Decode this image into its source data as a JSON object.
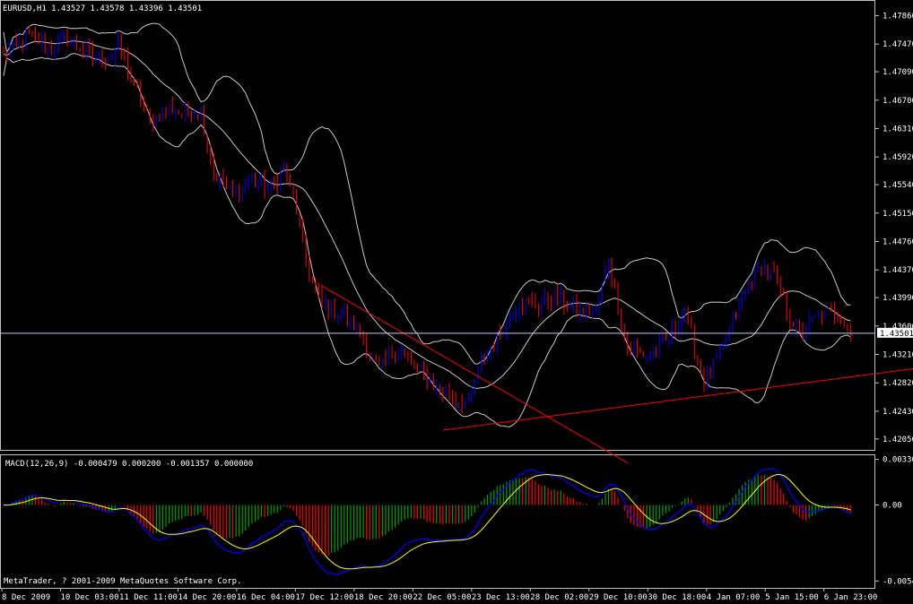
{
  "chart_data": [
    {
      "type": "candlestick",
      "symbol_header": "EURUSD,H1  1.43527 1.43578 1.43396 1.43501",
      "current_price": 1.43501,
      "current_price_label": "1.43501",
      "ylim": [
        1.419,
        1.4805
      ],
      "y_ticks": [
        {
          "v": 1.4786,
          "label": "1.47860"
        },
        {
          "v": 1.4747,
          "label": "1.47470"
        },
        {
          "v": 1.4709,
          "label": "1.47090"
        },
        {
          "v": 1.467,
          "label": "1.46700"
        },
        {
          "v": 1.4631,
          "label": "1.46310"
        },
        {
          "v": 1.4592,
          "label": "1.45920"
        },
        {
          "v": 1.4554,
          "label": "1.45540"
        },
        {
          "v": 1.4515,
          "label": "1.45150"
        },
        {
          "v": 1.4476,
          "label": "1.44760"
        },
        {
          "v": 1.4437,
          "label": "1.44370"
        },
        {
          "v": 1.4399,
          "label": "1.43990"
        },
        {
          "v": 1.436,
          "label": "1.43600"
        },
        {
          "v": 1.4321,
          "label": "1.43210"
        },
        {
          "v": 1.4282,
          "label": "1.42820"
        },
        {
          "v": 1.4243,
          "label": "1.42430"
        },
        {
          "v": 1.4205,
          "label": "1.42050"
        }
      ],
      "indicators": [
        "Bollinger Bands"
      ],
      "close_path_anchors": [
        [
          0,
          1.473
        ],
        [
          8,
          1.476
        ],
        [
          14,
          1.474
        ],
        [
          20,
          1.4755
        ],
        [
          28,
          1.473
        ],
        [
          34,
          1.473
        ],
        [
          36,
          1.475
        ],
        [
          40,
          1.47
        ],
        [
          46,
          1.464
        ],
        [
          52,
          1.466
        ],
        [
          56,
          1.465
        ],
        [
          62,
          1.4655
        ],
        [
          66,
          1.457
        ],
        [
          72,
          1.454
        ],
        [
          78,
          1.456
        ],
        [
          84,
          1.455
        ],
        [
          88,
          1.4575
        ],
        [
          92,
          1.452
        ],
        [
          96,
          1.443
        ],
        [
          100,
          1.439
        ],
        [
          106,
          1.438
        ],
        [
          112,
          1.435
        ],
        [
          118,
          1.43
        ],
        [
          124,
          1.433
        ],
        [
          130,
          1.43
        ],
        [
          136,
          1.4275
        ],
        [
          142,
          1.426
        ],
        [
          146,
          1.4255
        ],
        [
          150,
          1.431
        ],
        [
          156,
          1.435
        ],
        [
          162,
          1.4395
        ],
        [
          168,
          1.439
        ],
        [
          174,
          1.44
        ],
        [
          180,
          1.438
        ],
        [
          186,
          1.438
        ],
        [
          190,
          1.445
        ],
        [
          196,
          1.433
        ],
        [
          202,
          1.432
        ],
        [
          208,
          1.434
        ],
        [
          214,
          1.438
        ],
        [
          220,
          1.428
        ],
        [
          226,
          1.433
        ],
        [
          232,
          1.44
        ],
        [
          238,
          1.444
        ],
        [
          242,
          1.443
        ],
        [
          246,
          1.438
        ],
        [
          250,
          1.435
        ],
        [
          256,
          1.4375
        ],
        [
          262,
          1.438
        ],
        [
          266,
          1.435
        ]
      ],
      "trendlines": [
        {
          "from": [
            100,
            1.4415
          ],
          "to": [
            196,
            1.4172
          ],
          "color": "#ff0000"
        },
        {
          "from": [
            138,
            1.4217
          ],
          "to": [
            292,
            1.4305
          ],
          "color": "#ff0000"
        }
      ]
    },
    {
      "type": "bar+line",
      "title": "MACD(12,26,9) -0.000479 0.000200 -0.001357 0.000000",
      "ylim": [
        -0.006,
        0.0036
      ],
      "y_ticks": [
        {
          "v": 0.0033,
          "label": "0.00330"
        },
        {
          "v": 0.0,
          "label": "0.00"
        },
        {
          "v": -0.0055,
          "label": "-0.00548"
        }
      ],
      "series": [
        {
          "name": "",
          "kind": "histogram",
          "colors": [
            "#00a000",
            "#ff0000"
          ]
        },
        {
          "name": "",
          "kind": "line",
          "color": "#0000ff"
        },
        {
          "name": "",
          "kind": "line",
          "color": "#ffff00"
        }
      ]
    }
  ],
  "x_ticks": [
    {
      "i": 0,
      "label": "8 Dec 2009"
    },
    {
      "i": 16,
      "label": "10 Dec 03:00"
    },
    {
      "i": 32,
      "label": "11 Dec 11:00"
    },
    {
      "i": 48,
      "label": "14 Dec 20:00"
    },
    {
      "i": 64,
      "label": "16 Dec 04:00"
    },
    {
      "i": 80,
      "label": "17 Dec 12:00"
    },
    {
      "i": 96,
      "label": "18 Dec 20:00"
    },
    {
      "i": 112,
      "label": "22 Dec 05:00"
    },
    {
      "i": 128,
      "label": "23 Dec 13:00"
    },
    {
      "i": 144,
      "label": "28 Dec 02:00"
    },
    {
      "i": 160,
      "label": "29 Dec 10:00"
    },
    {
      "i": 176,
      "label": "30 Dec 18:00"
    },
    {
      "i": 192,
      "label": "4 Jan 07:00"
    },
    {
      "i": 208,
      "label": "5 Jan 15:00"
    },
    {
      "i": 224,
      "label": "6 Jan 23:00"
    }
  ],
  "copyright": "MetaTrader, ? 2001-2009 MetaQuotes Software Corp.",
  "colors": {
    "background": "#000000",
    "bull": "#0000ff",
    "bear": "#ff0000",
    "bands": "#c8c8c8",
    "grid_line": "#ffffff",
    "macd_main": "#0000ff",
    "macd_signal": "#ffff00"
  }
}
